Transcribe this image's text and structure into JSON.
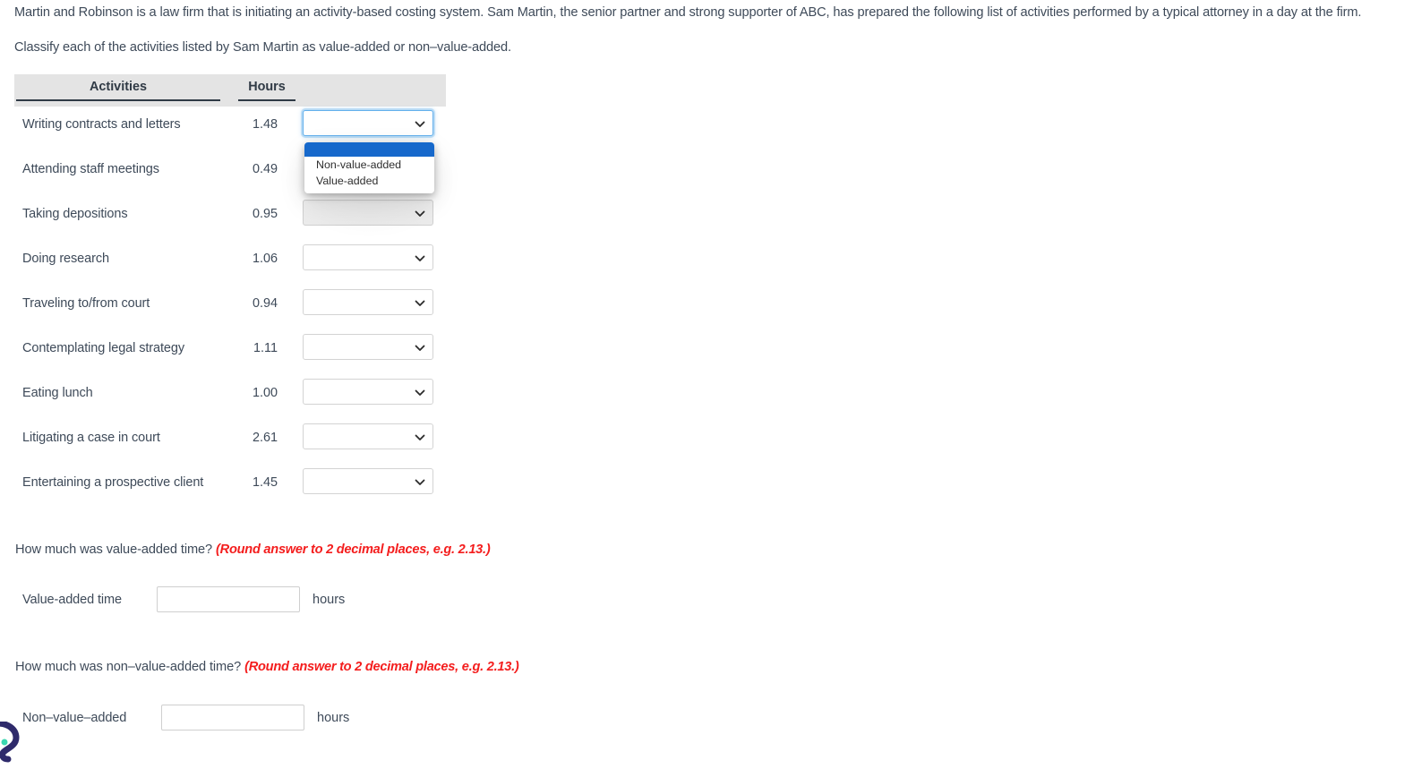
{
  "intro": {
    "paragraph1": "Martin and Robinson is a law firm that is initiating an activity-based costing system. Sam Martin, the senior partner and strong supporter of ABC, has prepared the following list of activities performed by a typical attorney in a day at the firm.",
    "paragraph2": "Classify each of the activities listed by Sam Martin as value-added or non–value-added."
  },
  "table": {
    "headers": {
      "activities": "Activities",
      "hours": "Hours",
      "classification": ""
    },
    "rows": [
      {
        "activity": "Writing contracts and letters",
        "hours": "1.48",
        "classification": ""
      },
      {
        "activity": "Attending staff meetings",
        "hours": "0.49",
        "classification": ""
      },
      {
        "activity": "Taking depositions",
        "hours": "0.95",
        "classification": ""
      },
      {
        "activity": "Doing research",
        "hours": "1.06",
        "classification": ""
      },
      {
        "activity": "Traveling to/from court",
        "hours": "0.94",
        "classification": ""
      },
      {
        "activity": "Contemplating legal strategy",
        "hours": "1.11",
        "classification": ""
      },
      {
        "activity": "Eating lunch",
        "hours": "1.00",
        "classification": ""
      },
      {
        "activity": "Litigating a case in court",
        "hours": "2.61",
        "classification": ""
      },
      {
        "activity": "Entertaining a prospective client",
        "hours": "1.45",
        "classification": ""
      }
    ]
  },
  "dropdown": {
    "open_for_row_index": 0,
    "options": [
      "",
      "Non-value-added",
      "Value-added"
    ],
    "option_blank": "",
    "option_non_value_added": "Non-value-added",
    "option_value_added": "Value-added",
    "highlighted_option": "",
    "chevron_icon": "chevron-down-icon"
  },
  "questions": [
    {
      "text": "How much was value-added time?",
      "hint": "(Round answer to 2 decimal places, e.g. 2.13.)",
      "answer_label": "Value-added time",
      "answer_value": "",
      "unit": "hours"
    },
    {
      "text": "How much was non–value-added time?",
      "hint": "(Round answer to 2 decimal places, e.g. 2.13.)",
      "answer_label": "Non–value–added",
      "answer_value": "",
      "unit": "hours"
    }
  ],
  "colors": {
    "background": "#ffffff",
    "text": "#3e4a59",
    "header_bg": "#e4e4e4",
    "hint_red": "#f41d1d",
    "highlight_blue": "#1668cb",
    "focus_border": "#63b0ec"
  }
}
